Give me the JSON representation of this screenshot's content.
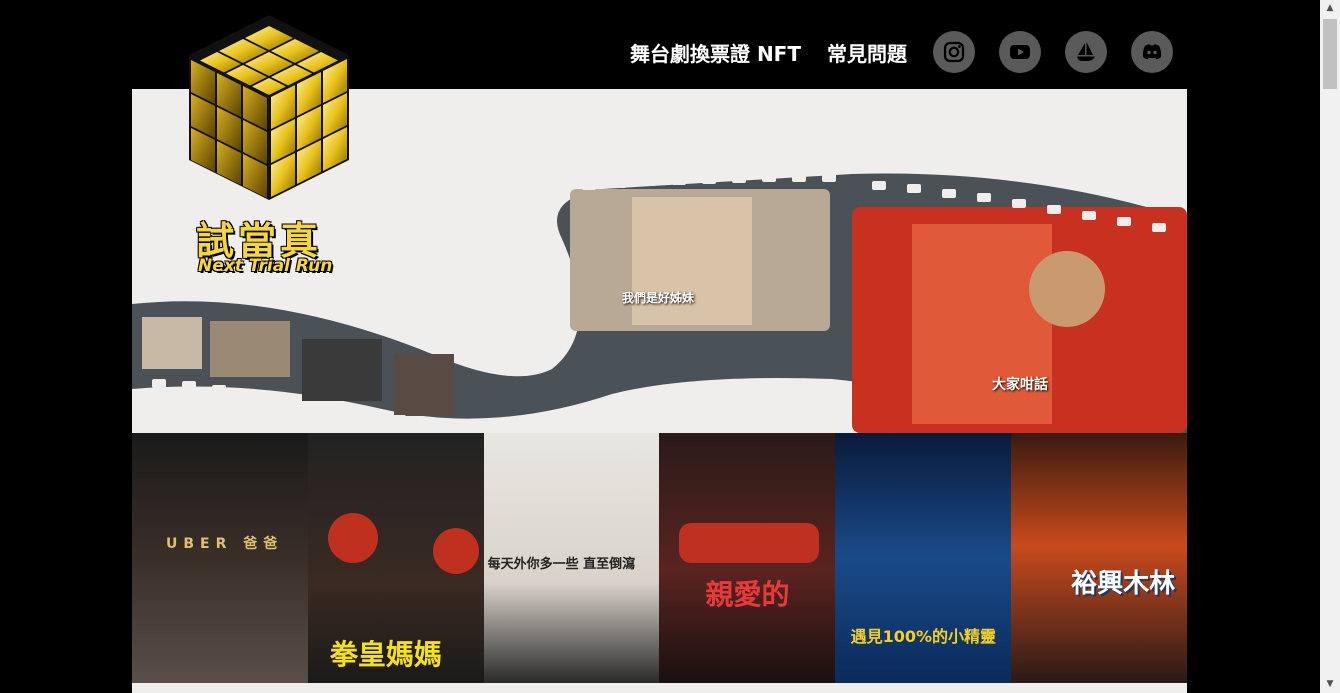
{
  "brand": {
    "name_zh": "試當真",
    "name_en": "Next Trial Run"
  },
  "nav": {
    "links": [
      "舞台劇換票證 NFT",
      "常見問題"
    ],
    "social": [
      "instagram-icon",
      "youtube-icon",
      "opensea-icon",
      "discord-icon"
    ]
  },
  "hero": {
    "captions": [
      "我們是好姊妹",
      "大家咁話"
    ]
  },
  "posters": [
    {
      "title": "UBER 爸爸",
      "color": "#2a2a2a"
    },
    {
      "title": "拳皇媽媽",
      "color": "#1a1a1a"
    },
    {
      "title": "每天外你多一些 直至倒瀉",
      "color": "#e9e7e2"
    },
    {
      "title": "親愛的",
      "color": "#3a1e1a"
    },
    {
      "title": "遇見100%的小精靈",
      "color": "#123a6a"
    },
    {
      "title": "裕興木林",
      "color": "#c84a1c"
    }
  ],
  "colors": {
    "gold": "#f5d640",
    "header_bg": "#000000",
    "social_bg": "#5a5a5a"
  }
}
